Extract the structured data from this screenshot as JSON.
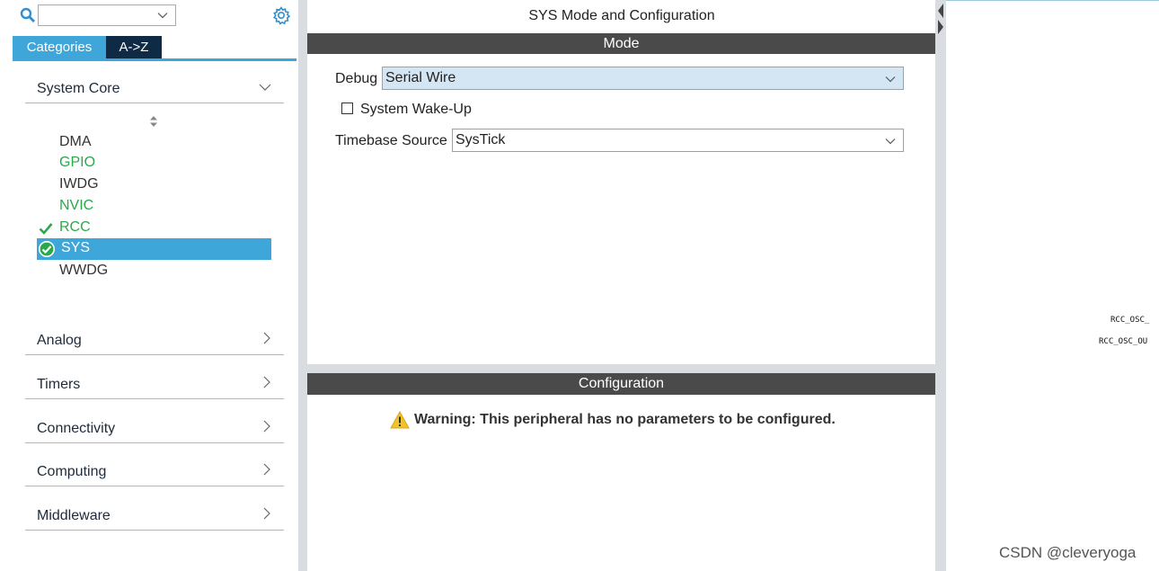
{
  "colors": {
    "accent": "#3ea6d8",
    "dark_tab": "#0e2a44",
    "section_bar": "#4a4a4a",
    "enabled_green": "#2aa84a",
    "warning_yellow": "#f2c12e"
  },
  "toolbar": {
    "search_icon": "search-icon",
    "search_value": "",
    "settings_icon": "gear-icon"
  },
  "tabs": [
    {
      "label": "Categories",
      "selected": true
    },
    {
      "label": "A->Z",
      "selected": false
    }
  ],
  "categories": {
    "system_core": {
      "label": "System Core",
      "expanded": true,
      "items": [
        {
          "label": "DMA",
          "state": "default"
        },
        {
          "label": "GPIO",
          "state": "enabled"
        },
        {
          "label": "IWDG",
          "state": "default"
        },
        {
          "label": "NVIC",
          "state": "enabled"
        },
        {
          "label": "RCC",
          "state": "configured"
        },
        {
          "label": "SYS",
          "state": "selected"
        },
        {
          "label": "WWDG",
          "state": "default"
        }
      ]
    },
    "collapsed": [
      {
        "label": "Analog"
      },
      {
        "label": "Timers"
      },
      {
        "label": "Connectivity"
      },
      {
        "label": "Computing"
      },
      {
        "label": "Middleware"
      }
    ]
  },
  "panel": {
    "title": "SYS Mode and Configuration",
    "mode_header": "Mode",
    "debug_label": "Debug",
    "debug_value": "Serial Wire",
    "wakeup_label": "System Wake-Up",
    "wakeup_checked": false,
    "timebase_label": "Timebase Source",
    "timebase_value": "SysTick",
    "config_header": "Configuration",
    "warning_text": "Warning: This peripheral has no parameters to be configured."
  },
  "chip_view": {
    "pin_labels": [
      "RCC_OSC_",
      "RCC_OSC_OU"
    ]
  },
  "watermark": "CSDN @cleveryoga"
}
